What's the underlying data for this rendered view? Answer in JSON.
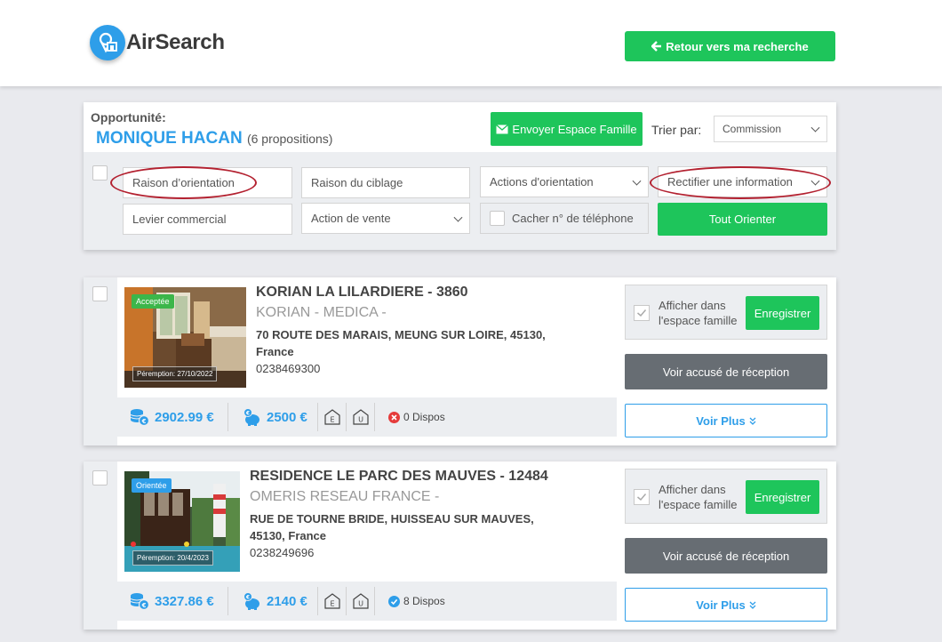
{
  "app": {
    "name": "AirSearch",
    "back_label": "Retour vers ma recherche"
  },
  "opportunity": {
    "label": "Opportunité:",
    "name": "MONIQUE HACAN",
    "count": "(6 propositions)",
    "send_label": "Envoyer Espace Famille",
    "sort_label": "Trier par:",
    "sort_value": "Commission"
  },
  "filters": {
    "raison_orientation": "Raison d’orientation",
    "raison_ciblage": "Raison du ciblage",
    "actions_orientation": "Actions d'orientation",
    "rectifier": "Rectifier une information",
    "levier": "Levier commercial",
    "action_vente": "Action de vente",
    "cacher_tel": "Cacher n° de téléphone",
    "orient_all": "Tout Orienter"
  },
  "colors": {
    "green": "#1ec55b",
    "blue": "#2e9ee9",
    "grey_button": "#676d73",
    "highlight": "#b32130"
  },
  "results": [
    {
      "status": "Acceptée",
      "status_color": "#3cb64a",
      "expiry": "Péremption: 27/10/2022",
      "title": "KORIAN LA LILARDIERE  - 3860",
      "group": "KORIAN - MEDICA -",
      "address": "70 ROUTE DES MARAIS, MEUNG SUR LOIRE, 45130, France",
      "phone": "0238469300",
      "commission": "2902.99 €",
      "price": "2500 €",
      "dispos": "0 Dispos",
      "dispos_status": "none",
      "show_family": "Afficher dans l'espace famille",
      "save_label": "Enregistrer",
      "receipt_label": "Voir accusé de réception",
      "more_label": "Voir Plus"
    },
    {
      "status": "Orientée",
      "status_color": "#2e9ee9",
      "expiry": "Péremption: 20/4/2023",
      "title": "RESIDENCE LE PARC DES MAUVES  - 12484",
      "group": "OMERIS RESEAU FRANCE -",
      "address": "RUE DE TOURNE BRIDE, HUISSEAU SUR MAUVES, 45130, France",
      "phone": "0238249696",
      "commission": "3327.86 €",
      "price": "2140 €",
      "dispos": "8 Dispos",
      "dispos_status": "available",
      "show_family": "Afficher dans l'espace famille",
      "save_label": "Enregistrer",
      "receipt_label": "Voir accusé de réception",
      "more_label": "Voir Plus"
    }
  ]
}
